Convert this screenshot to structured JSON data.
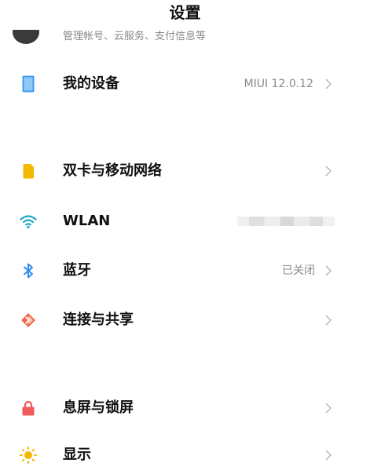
{
  "header": {
    "title": "设置"
  },
  "account": {
    "description": "管理帐号、云服务、支付信息等"
  },
  "items": [
    {
      "label": "我的设备",
      "value": "MIUI 12.0.12",
      "icon": "device-icon",
      "color": "#3f9cf0"
    },
    {
      "label": "双卡与移动网络",
      "value": "",
      "icon": "sim-card-icon",
      "color": "#f5b800"
    },
    {
      "label": "WLAN",
      "value": "",
      "icon": "wifi-icon",
      "color": "#1aa7c4"
    },
    {
      "label": "蓝牙",
      "value": "已关闭",
      "icon": "bluetooth-icon",
      "color": "#2d8cf0"
    },
    {
      "label": "连接与共享",
      "value": "",
      "icon": "connection-sharing-icon",
      "color": "#f06a4a"
    },
    {
      "label": "息屏与锁屏",
      "value": "",
      "icon": "lock-icon",
      "color": "#f05a5a"
    },
    {
      "label": "显示",
      "value": "",
      "icon": "sun-icon",
      "color": "#f5b800"
    }
  ]
}
